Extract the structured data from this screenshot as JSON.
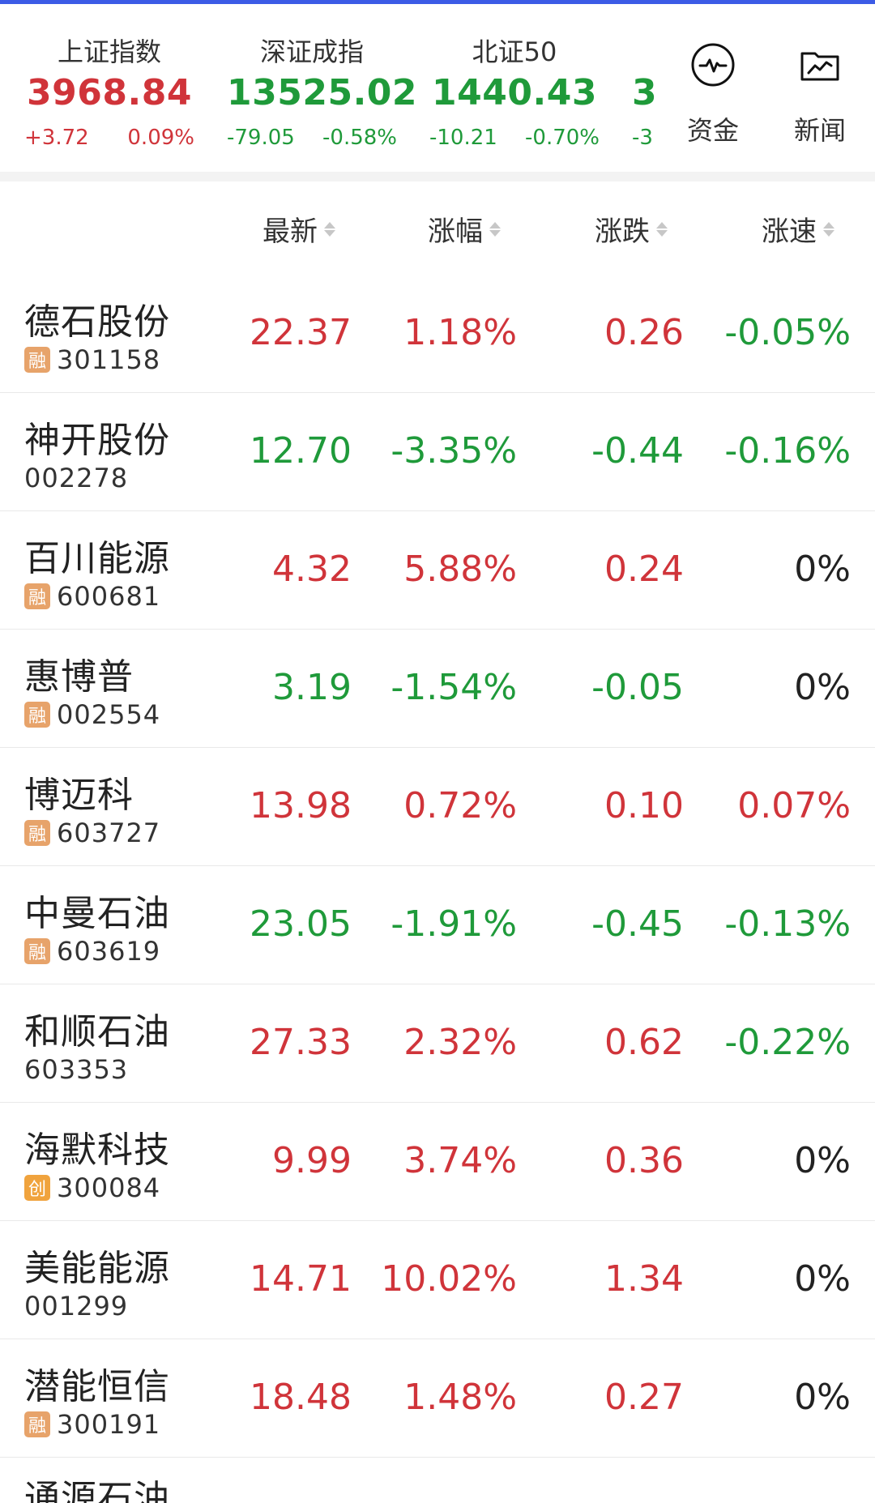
{
  "colors": {
    "up": "#d0343a",
    "down": "#1f9a3a",
    "divider": "#e9e9e9",
    "topline": "#3c5be6",
    "rong_tag": "#e7a36a",
    "chuang_tag": "#f0a33d"
  },
  "indices": [
    {
      "name": "上证指数",
      "value": "3968.84",
      "change": "+3.72",
      "pct": "0.09%",
      "trend": "up"
    },
    {
      "name": "深证成指",
      "value": "13525.02",
      "change": "-79.05",
      "pct": "-0.58%",
      "trend": "down"
    },
    {
      "name": "北证50",
      "value": "1440.43",
      "change": "-10.21",
      "pct": "-0.70%",
      "trend": "down"
    },
    {
      "name": "",
      "value": "3",
      "change": "-3",
      "pct": "",
      "trend": "down"
    }
  ],
  "tools": [
    {
      "label": "资金",
      "icon": "pulse-icon"
    },
    {
      "label": "新闻",
      "icon": "folder-chart-icon"
    }
  ],
  "table": {
    "headers": [
      "最新",
      "涨幅",
      "涨跌",
      "涨速"
    ],
    "rows": [
      {
        "name": "德石股份",
        "tag": "融",
        "tag_type": "rong",
        "code": "301158",
        "last": "22.37",
        "pct": "1.18%",
        "chg": "0.26",
        "speed": "-0.05%",
        "last_color": "red",
        "pct_color": "red",
        "chg_color": "red",
        "speed_color": "green"
      },
      {
        "name": "神开股份",
        "tag": "",
        "tag_type": "",
        "code": "002278",
        "last": "12.70",
        "pct": "-3.35%",
        "chg": "-0.44",
        "speed": "-0.16%",
        "last_color": "green",
        "pct_color": "green",
        "chg_color": "green",
        "speed_color": "green"
      },
      {
        "name": "百川能源",
        "tag": "融",
        "tag_type": "rong",
        "code": "600681",
        "last": "4.32",
        "pct": "5.88%",
        "chg": "0.24",
        "speed": "0%",
        "last_color": "red",
        "pct_color": "red",
        "chg_color": "red",
        "speed_color": "black"
      },
      {
        "name": "惠博普",
        "tag": "融",
        "tag_type": "rong",
        "code": "002554",
        "last": "3.19",
        "pct": "-1.54%",
        "chg": "-0.05",
        "speed": "0%",
        "last_color": "green",
        "pct_color": "green",
        "chg_color": "green",
        "speed_color": "black"
      },
      {
        "name": "博迈科",
        "tag": "融",
        "tag_type": "rong",
        "code": "603727",
        "last": "13.98",
        "pct": "0.72%",
        "chg": "0.10",
        "speed": "0.07%",
        "last_color": "red",
        "pct_color": "red",
        "chg_color": "red",
        "speed_color": "red"
      },
      {
        "name": "中曼石油",
        "tag": "融",
        "tag_type": "rong",
        "code": "603619",
        "last": "23.05",
        "pct": "-1.91%",
        "chg": "-0.45",
        "speed": "-0.13%",
        "last_color": "green",
        "pct_color": "green",
        "chg_color": "green",
        "speed_color": "green"
      },
      {
        "name": "和顺石油",
        "tag": "",
        "tag_type": "",
        "code": "603353",
        "last": "27.33",
        "pct": "2.32%",
        "chg": "0.62",
        "speed": "-0.22%",
        "last_color": "red",
        "pct_color": "red",
        "chg_color": "red",
        "speed_color": "green"
      },
      {
        "name": "海默科技",
        "tag": "创",
        "tag_type": "chuang",
        "code": "300084",
        "last": "9.99",
        "pct": "3.74%",
        "chg": "0.36",
        "speed": "0%",
        "last_color": "red",
        "pct_color": "red",
        "chg_color": "red",
        "speed_color": "black"
      },
      {
        "name": "美能能源",
        "tag": "",
        "tag_type": "",
        "code": "001299",
        "last": "14.71",
        "pct": "10.02%",
        "chg": "1.34",
        "speed": "0%",
        "last_color": "red",
        "pct_color": "red",
        "chg_color": "red",
        "speed_color": "black"
      },
      {
        "name": "潜能恒信",
        "tag": "融",
        "tag_type": "rong",
        "code": "300191",
        "last": "18.48",
        "pct": "1.48%",
        "chg": "0.27",
        "speed": "0%",
        "last_color": "red",
        "pct_color": "red",
        "chg_color": "red",
        "speed_color": "black"
      }
    ],
    "partial_row": {
      "name": "通源石油"
    }
  }
}
